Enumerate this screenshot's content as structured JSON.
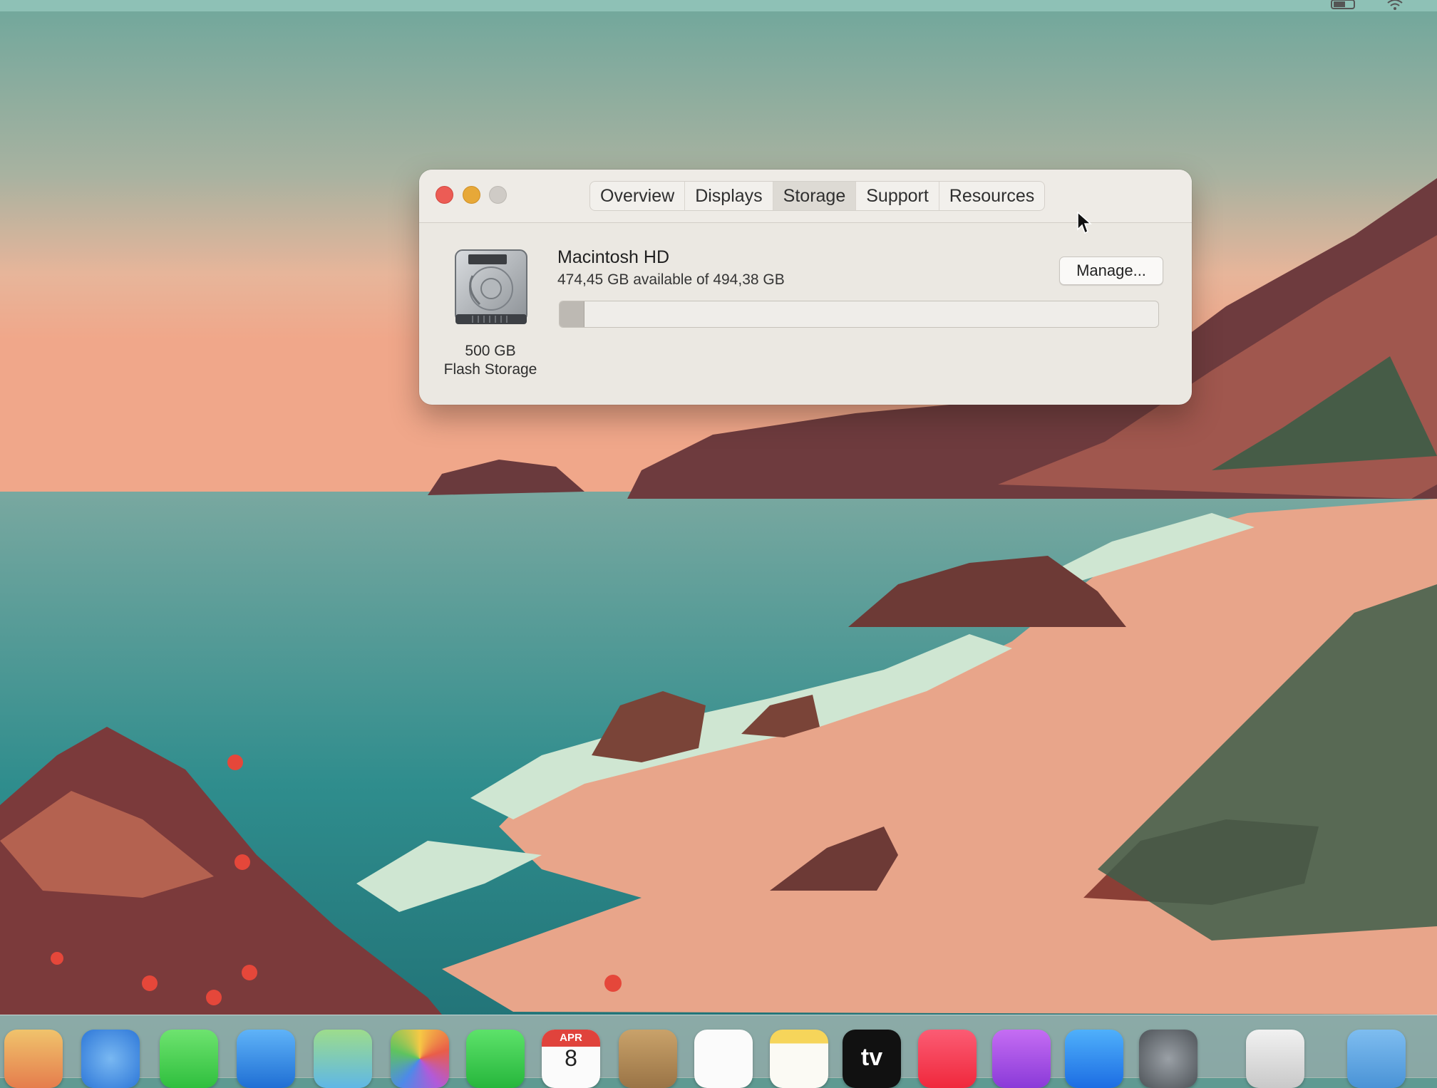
{
  "window": {
    "tabs": [
      {
        "label": "Overview"
      },
      {
        "label": "Displays"
      },
      {
        "label": "Storage"
      },
      {
        "label": "Support"
      },
      {
        "label": "Resources"
      }
    ],
    "active_tab": "Storage"
  },
  "storage": {
    "volume_name": "Macintosh HD",
    "availability": "474,45 GB available of 494,38 GB",
    "capacity": "500 GB",
    "type": "Flash Storage",
    "manage_label": "Manage...",
    "used_fraction": 0.04
  },
  "dock": {
    "calendar": {
      "month": "APR",
      "day": "8"
    },
    "tv_label": "tv"
  },
  "icons": [
    "hard-disk-icon",
    "pointer-cursor-icon",
    "battery-icon",
    "wifi-icon"
  ],
  "colors": {
    "close": "#ec5c55",
    "minimize": "#e7a838",
    "zoom": "#cfcbc6",
    "window_bg": "#ebe8e2"
  }
}
